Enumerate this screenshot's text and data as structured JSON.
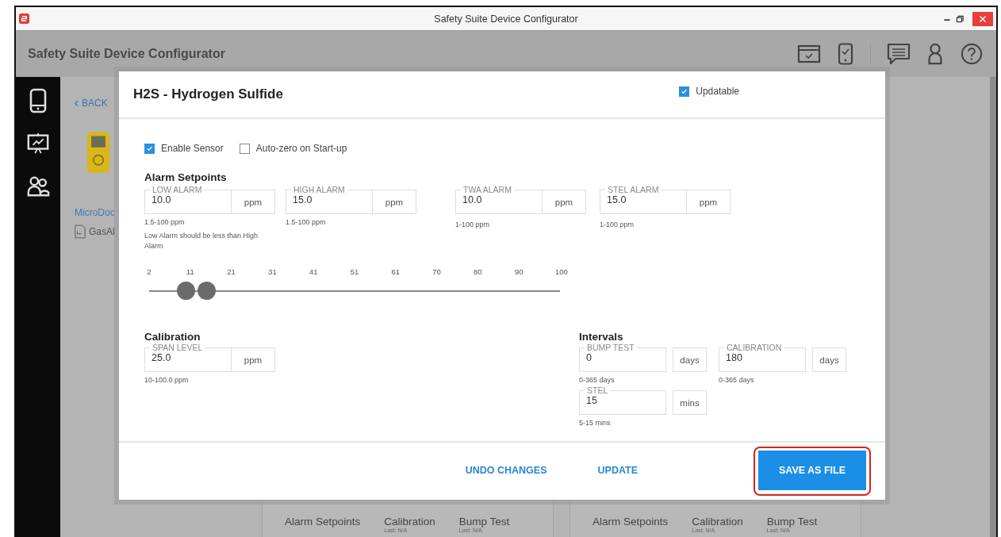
{
  "window": {
    "title": "Safety Suite Device Configurator"
  },
  "app_header": {
    "title": "Safety Suite Device Configurator"
  },
  "background": {
    "back_link": "BACK",
    "device_name": "MicroDoc",
    "file_name": "GasAl",
    "cards": [
      {
        "items": [
          {
            "label": "Alarm Setpoints"
          },
          {
            "label": "Calibration",
            "sub": "Last: N/A"
          },
          {
            "label": "Bump Test",
            "sub": "Last: N/A"
          }
        ]
      },
      {
        "items": [
          {
            "label": "Alarm Setpoints"
          },
          {
            "label": "Calibration",
            "sub": "Last: N/A"
          },
          {
            "label": "Bump Test",
            "sub": "Last: N/A"
          }
        ]
      }
    ]
  },
  "dialog": {
    "title": "H2S - Hydrogen Sulfide",
    "updatable": {
      "label": "Updatable",
      "checked": true
    },
    "options": [
      {
        "label": "Enable Sensor",
        "checked": true
      },
      {
        "label": "Auto-zero on Start-up",
        "checked": false
      }
    ],
    "alarm_setpoints": {
      "heading": "Alarm Setpoints",
      "fields": [
        {
          "label": "LOW ALARM",
          "value": "10.0",
          "unit": "ppm",
          "hints": [
            "1.5-100 ppm",
            "Low Alarm should be less than High Alarm"
          ]
        },
        {
          "label": "HIGH ALARM",
          "value": "15.0",
          "unit": "ppm",
          "hints": [
            "1.5-100 ppm"
          ]
        },
        {
          "label": "TWA ALARM",
          "value": "10.0",
          "unit": "ppm",
          "hints": [
            "1-100 ppm"
          ]
        },
        {
          "label": "STEL ALARM",
          "value": "15.0",
          "unit": "ppm",
          "hints": [
            "1-100 ppm"
          ]
        }
      ]
    },
    "slider": {
      "ticks": [
        "2",
        "11",
        "21",
        "31",
        "41",
        "51",
        "61",
        "70",
        "80",
        "90",
        "100"
      ],
      "thumbs": [
        {
          "level": 0.089
        },
        {
          "level": 0.139
        }
      ]
    },
    "calibration": {
      "heading": "Calibration",
      "fields": [
        {
          "label": "SPAN LEVEL",
          "value": "25.0",
          "unit": "ppm",
          "hints": [
            "10-100.0 ppm"
          ]
        }
      ]
    },
    "intervals": {
      "heading": "Intervals",
      "fields": [
        {
          "label": "BUMP TEST",
          "value": "0",
          "unit": "days",
          "hints": [
            "0-365 days"
          ]
        },
        {
          "label": "CALIBRATION",
          "value": "180",
          "unit": "days",
          "hints": [
            "0-365 days"
          ]
        },
        {
          "label": "STEL",
          "value": "15",
          "unit": "mins",
          "hints": [
            "5-15 mins"
          ]
        }
      ]
    },
    "buttons": [
      {
        "label": "UNDO CHANGES",
        "kind": "text",
        "highlighted": false
      },
      {
        "label": "UPDATE",
        "kind": "text",
        "highlighted": false
      },
      {
        "label": "SAVE AS FILE",
        "kind": "primary",
        "highlighted": true
      }
    ]
  }
}
